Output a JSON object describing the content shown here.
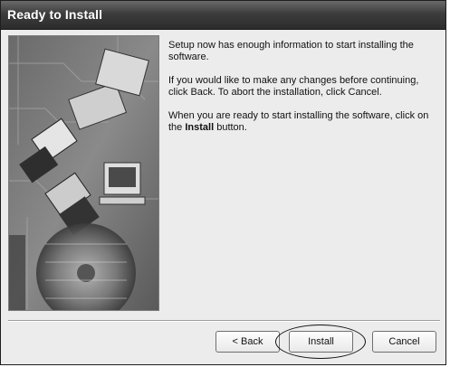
{
  "window": {
    "title": "Ready to Install"
  },
  "body": {
    "para1": "Setup now has enough information to start installing the software.",
    "para2": "If you would like to make any changes before continuing, click Back.  To abort the installation, click Cancel.",
    "para3_prefix": "When you are ready to start installing the software, click on the ",
    "para3_bold": "Install",
    "para3_suffix": " button."
  },
  "buttons": {
    "back": "< Back",
    "install": "Install",
    "cancel": "Cancel"
  },
  "colors": {
    "titlebar": "#3c3c3c",
    "dialog_background": "#ececec"
  },
  "icons": {
    "side_image": "installer-artwork-image"
  }
}
